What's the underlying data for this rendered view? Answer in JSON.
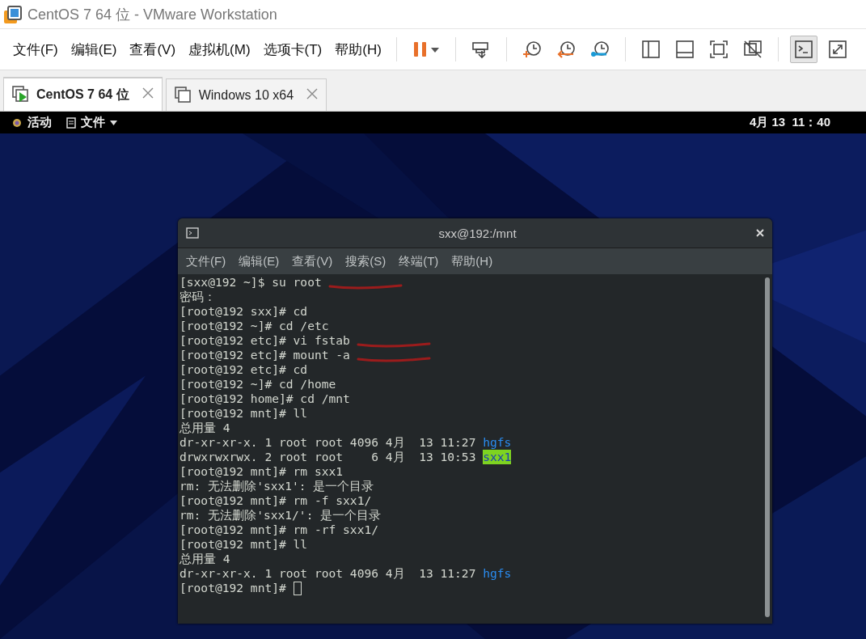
{
  "window": {
    "title": "CentOS 7 64 位 - VMware Workstation"
  },
  "menu": [
    "文件(F)",
    "编辑(E)",
    "查看(V)",
    "虚拟机(M)",
    "选项卡(T)",
    "帮助(H)"
  ],
  "toolbar": [
    {
      "kind": "pause",
      "selected": false
    },
    {
      "kind": "send-keys",
      "selected": false
    },
    {
      "kind": "snapshot-take",
      "selected": false
    },
    {
      "kind": "snapshot-revert",
      "selected": false
    },
    {
      "kind": "snapshot-manager",
      "selected": false
    },
    {
      "kind": "library",
      "selected": false
    },
    {
      "kind": "thumbnail",
      "selected": false
    },
    {
      "kind": "fit",
      "selected": false
    },
    {
      "kind": "unity",
      "selected": false
    },
    {
      "kind": "console",
      "selected": true
    },
    {
      "kind": "fullscreen",
      "selected": false
    }
  ],
  "tabs": [
    {
      "label": "CentOS 7 64 位",
      "selected": true
    },
    {
      "label": "Windows 10 x64",
      "selected": false
    }
  ],
  "guest_bar": {
    "activities": "活动",
    "app_menu": "文件",
    "clock": "4月 13  11：40"
  },
  "terminal": {
    "title": "sxx@192:/mnt",
    "menu": [
      "文件(F)",
      "编辑(E)",
      "查看(V)",
      "搜索(S)",
      "终端(T)",
      "帮助(H)"
    ],
    "lines": [
      {
        "text": "[sxx@192 ~]$ su root",
        "underlined": true
      },
      {
        "text": "密码：",
        "underlined": false
      },
      {
        "text": "[root@192 sxx]# cd",
        "underlined": false
      },
      {
        "text": "[root@192 ~]# cd /etc",
        "underlined": false
      },
      {
        "text": "[root@192 etc]# vi fstab",
        "underlined": true
      },
      {
        "text": "[root@192 etc]# mount -a",
        "underlined": true
      },
      {
        "text": "[root@192 etc]# cd",
        "underlined": false
      },
      {
        "text": "[root@192 ~]# cd /home",
        "underlined": false
      },
      {
        "text": "[root@192 home]# cd /mnt",
        "underlined": false
      },
      {
        "text": "[root@192 mnt]# ll",
        "underlined": false
      },
      {
        "text": "总用量 4",
        "underlined": false
      },
      {
        "text": "dr-xr-xr-x. 1 root root 4096 4月  13 11:27 ",
        "entry": {
          "name": "hgfs",
          "kind": "dir"
        },
        "underlined": false
      },
      {
        "text": "drwxrwxrwx. 2 root root    6 4月  13 10:53 ",
        "entry": {
          "name": "sxx1",
          "kind": "other-writable"
        },
        "underlined": false
      },
      {
        "text": "[root@192 mnt]# rm sxx1",
        "underlined": false
      },
      {
        "text": "rm: 无法删除'sxx1': 是一个目录",
        "underlined": false
      },
      {
        "text": "[root@192 mnt]# rm -f sxx1/",
        "underlined": false
      },
      {
        "text": "rm: 无法删除'sxx1/': 是一个目录",
        "underlined": false
      },
      {
        "text": "[root@192 mnt]# rm -rf sxx1/",
        "underlined": false
      },
      {
        "text": "[root@192 mnt]# ll",
        "underlined": false
      },
      {
        "text": "总用量 4",
        "underlined": false
      },
      {
        "text": "dr-xr-xr-x. 1 root root 4096 4月  13 11:27 ",
        "entry": {
          "name": "hgfs",
          "kind": "dir"
        },
        "underlined": false
      }
    ],
    "prompt": "[root@192 mnt]# "
  }
}
